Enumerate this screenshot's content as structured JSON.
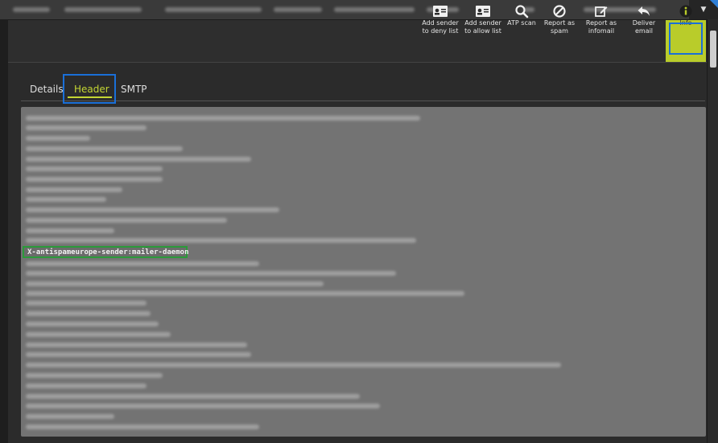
{
  "toolbar": {
    "buttons": [
      {
        "id": "deny",
        "label": "Add sender\nto deny list",
        "icon": "id-card-icon"
      },
      {
        "id": "allow",
        "label": "Add sender\nto allow list",
        "icon": "id-card-icon"
      },
      {
        "id": "atp",
        "label": "ATP scan",
        "icon": "search-icon"
      },
      {
        "id": "spam",
        "label": "Report as\nspam",
        "icon": "ban-icon"
      },
      {
        "id": "infomail",
        "label": "Report as\ninfomail",
        "icon": "edit-icon"
      },
      {
        "id": "deliver",
        "label": "Deliver\nemail",
        "icon": "reply-icon"
      },
      {
        "id": "info",
        "label": "Info",
        "icon": "info-icon"
      }
    ]
  },
  "tabs": {
    "details": "Details",
    "header": "Header",
    "smtp": "SMTP",
    "active": "Header"
  },
  "header_panel": {
    "highlighted_line": "X-antispameurope-sender:mailer-daemon"
  },
  "colors": {
    "accent": "#c4d633",
    "outline_blue": "#1a6fd8",
    "outline_green": "#2b9a3a",
    "panel_bg": "#737373"
  }
}
